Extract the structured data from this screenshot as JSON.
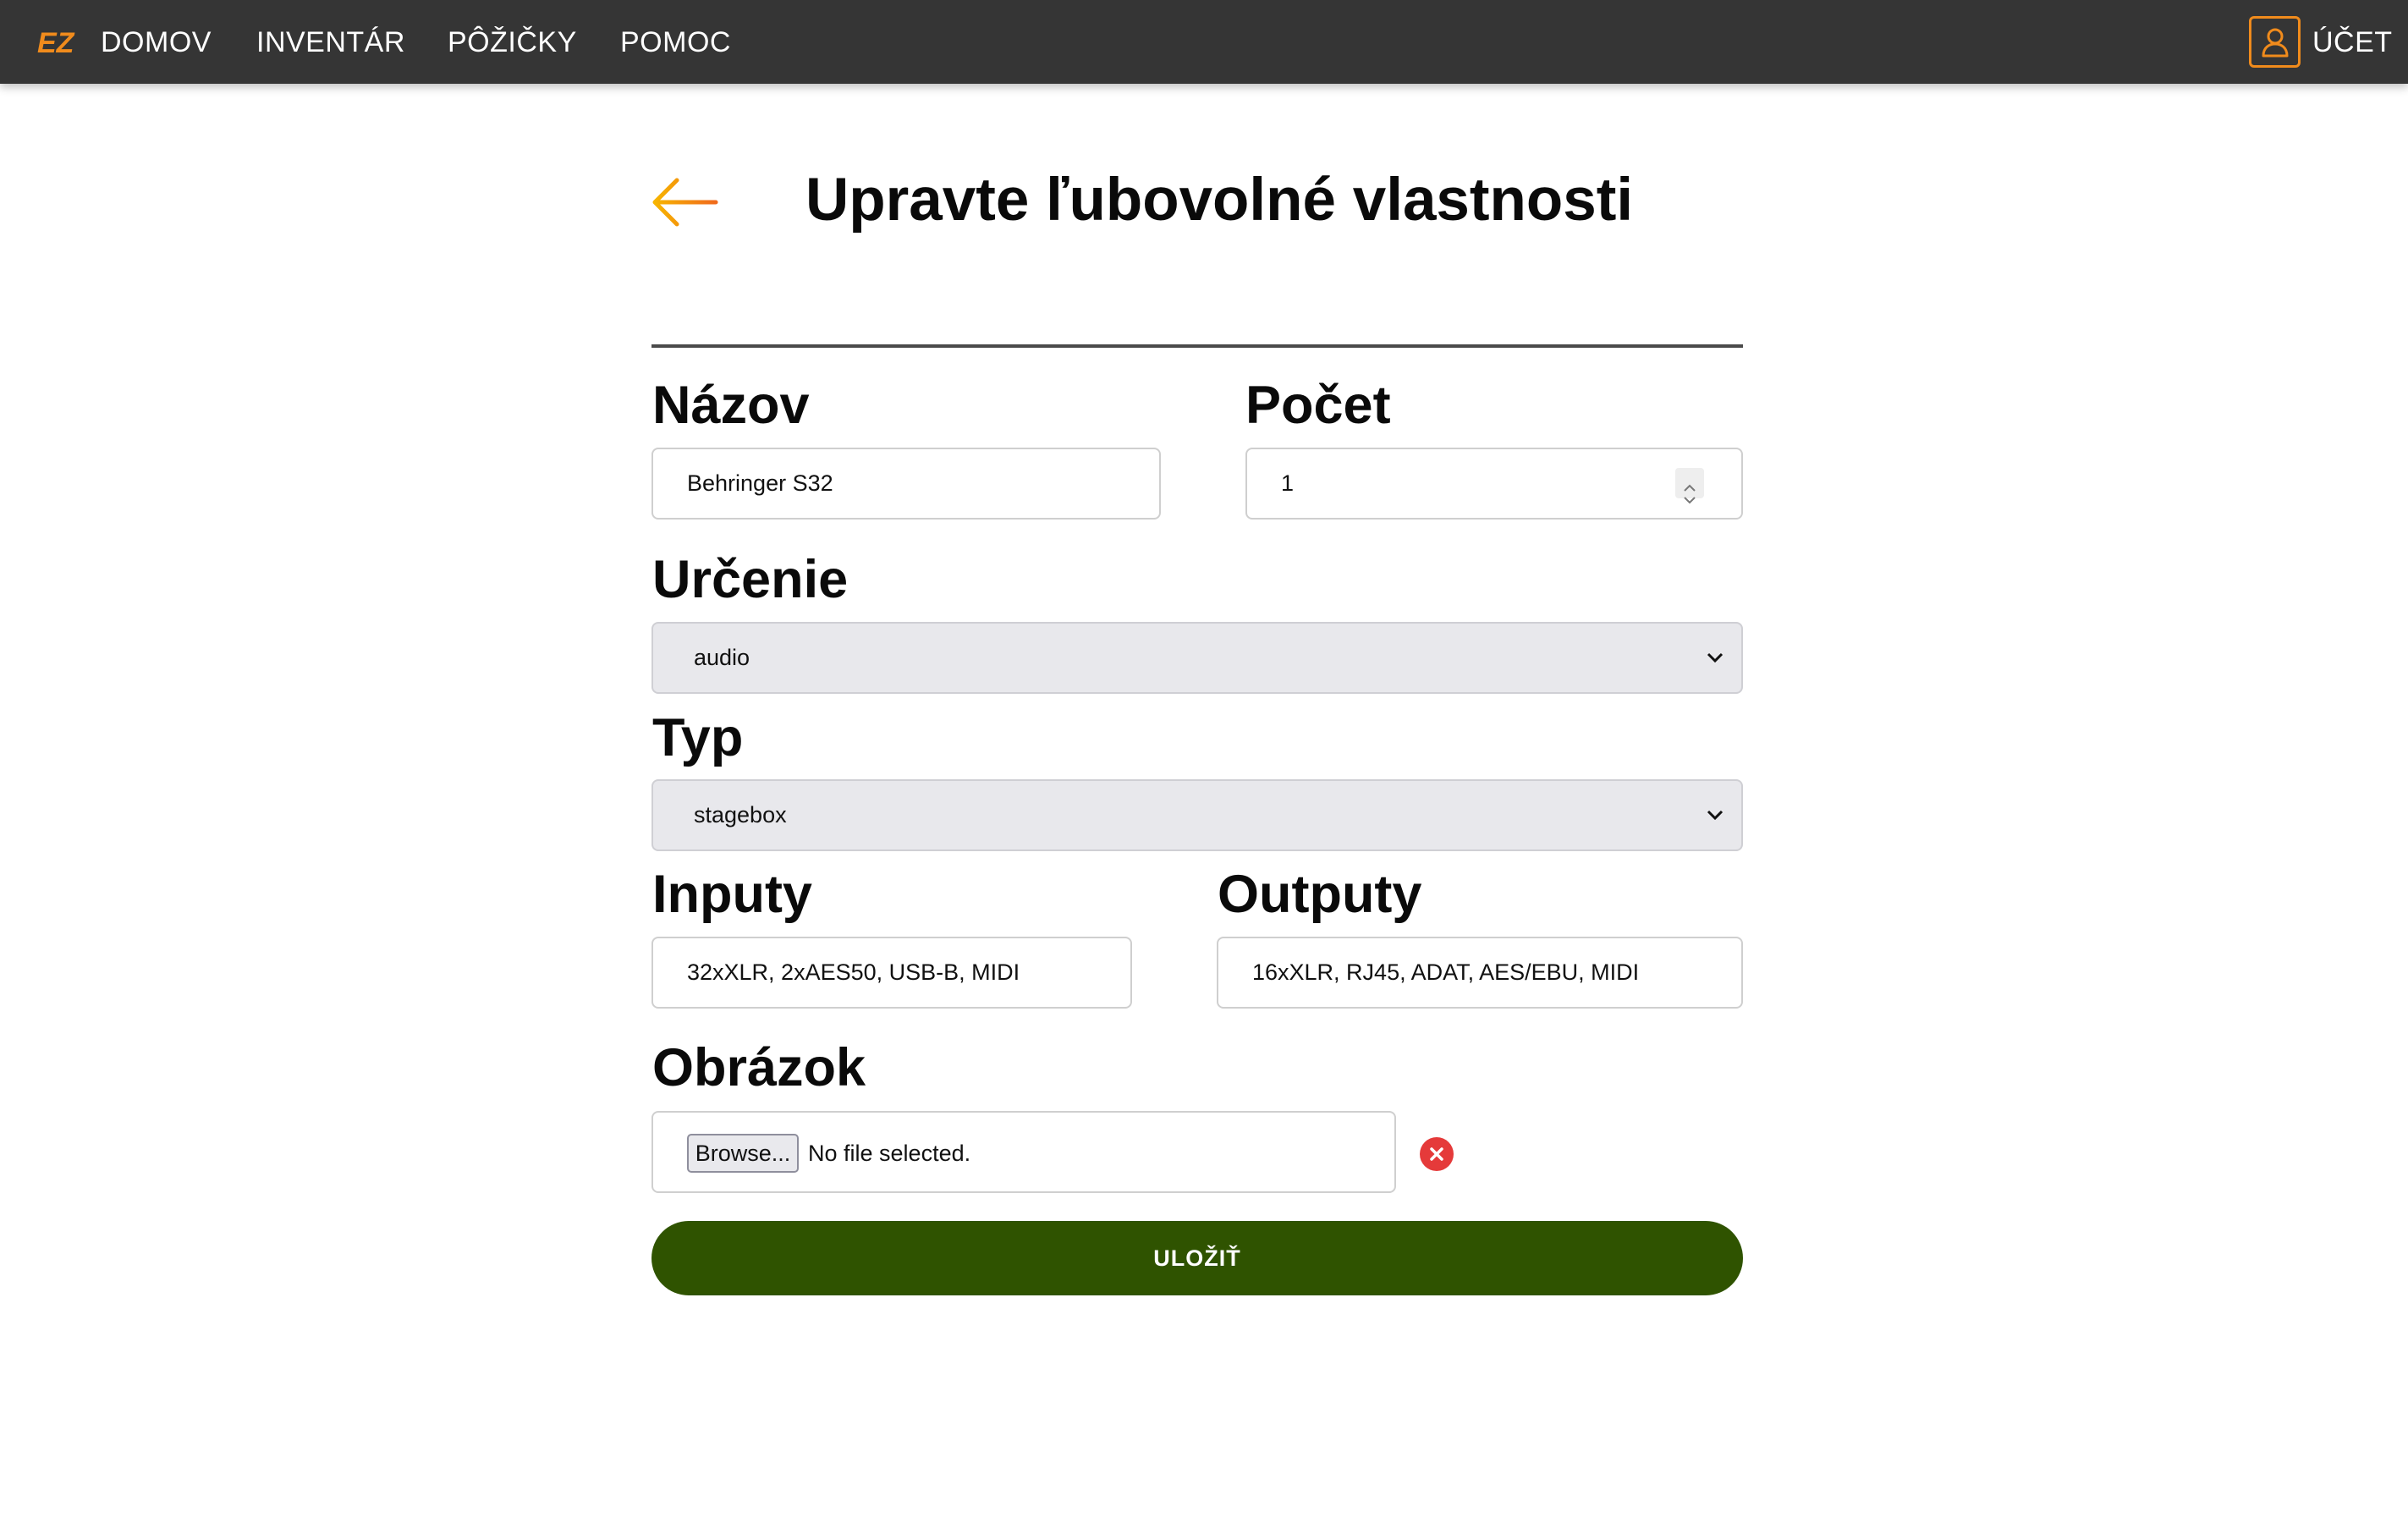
{
  "nav": {
    "logo_text": "EZ",
    "items": [
      {
        "label": "DOMOV"
      },
      {
        "label": "INVENTÁR"
      },
      {
        "label": "PÔŽIČKY"
      },
      {
        "label": "POMOC"
      }
    ],
    "account_label": "ÚČET"
  },
  "page": {
    "title": "Upravte ľubovolné vlastnosti"
  },
  "form": {
    "name": {
      "label": "Názov",
      "value": "Behringer S32"
    },
    "count": {
      "label": "Počet",
      "value": "1"
    },
    "purpose": {
      "label": "Určenie",
      "value": "audio"
    },
    "type": {
      "label": "Typ",
      "value": "stagebox"
    },
    "inputs": {
      "label": "Inputy",
      "value": "32xXLR, 2xAES50, USB-B, MIDI"
    },
    "outputs": {
      "label": "Outputy",
      "value": "16xXLR, RJ45, ADAT, AES/EBU, MIDI"
    },
    "image": {
      "label": "Obrázok",
      "browse_label": "Browse...",
      "status": "No file selected."
    },
    "save_label": "ULOŽIŤ"
  },
  "colors": {
    "nav_bg": "#353535",
    "accent_orange": "#f08b1c",
    "save_green": "#2f5300",
    "clear_red": "#e53a3a"
  }
}
